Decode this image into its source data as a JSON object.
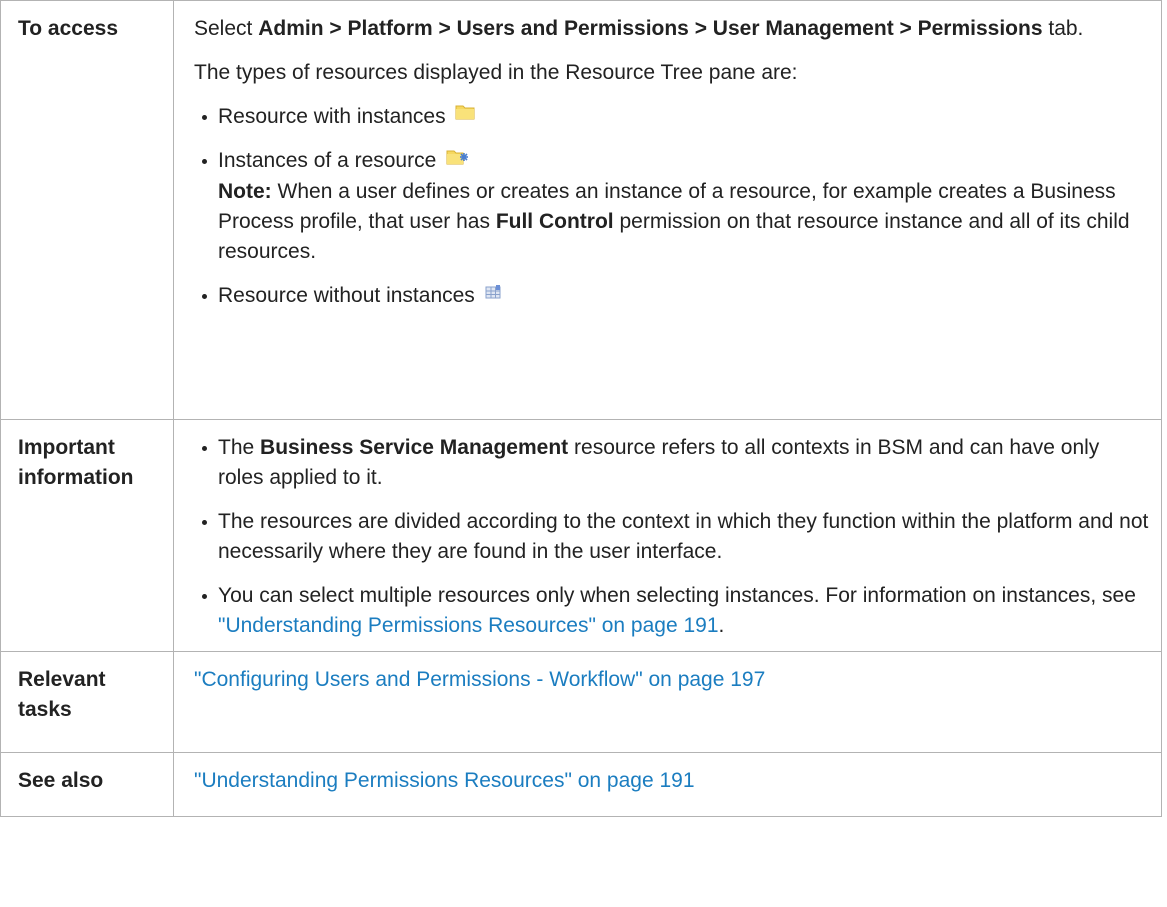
{
  "rows": [
    {
      "label": "To access",
      "access_prefix": "Select",
      "access_path": "Admin > Platform > Users and Permissions > User Management > Permissions",
      "access_suffix": "tab.",
      "intro": "The types of resources displayed in the Resource Tree pane are:",
      "items": [
        {
          "text": "Resource with instances",
          "icon": "folder-icon"
        },
        {
          "text": "Instances of a resource",
          "icon": "folder-instance-icon"
        },
        {
          "text": "Resource without instances",
          "icon": "resource-grid-icon"
        }
      ],
      "note_label": "Note:",
      "note_text_1": "When a user defines or creates an instance of a resource, for example creates a Business Process profile, that user has",
      "note_bold": "Full Control",
      "note_text_2": "permission on that resource instance and all of its child resources."
    },
    {
      "label": "Important information",
      "bullet1_prefix": "The",
      "bullet1_bold": "Business Service Management",
      "bullet1_suffix": "resource refers to all contexts in BSM and can have only roles applied to it.",
      "bullet2": "The resources are divided according to the context in which they function within the platform and not necessarily where they are found in the user interface.",
      "bullet3_text": "You can select multiple resources only when selecting instances. For information on instances, see",
      "bullet3_link": "\"Understanding Permissions Resources\" on page 191",
      "bullet3_end": "."
    },
    {
      "label": "Relevant tasks",
      "link": "\"Configuring Users and Permissions - Workflow\" on page 197"
    },
    {
      "label": "See also",
      "link": "\"Understanding Permissions Resources\" on page 191"
    }
  ],
  "colors": {
    "link": "#1b7dc0",
    "border": "#b3b3b3",
    "text": "#222222",
    "folder": "#f4d35e"
  }
}
